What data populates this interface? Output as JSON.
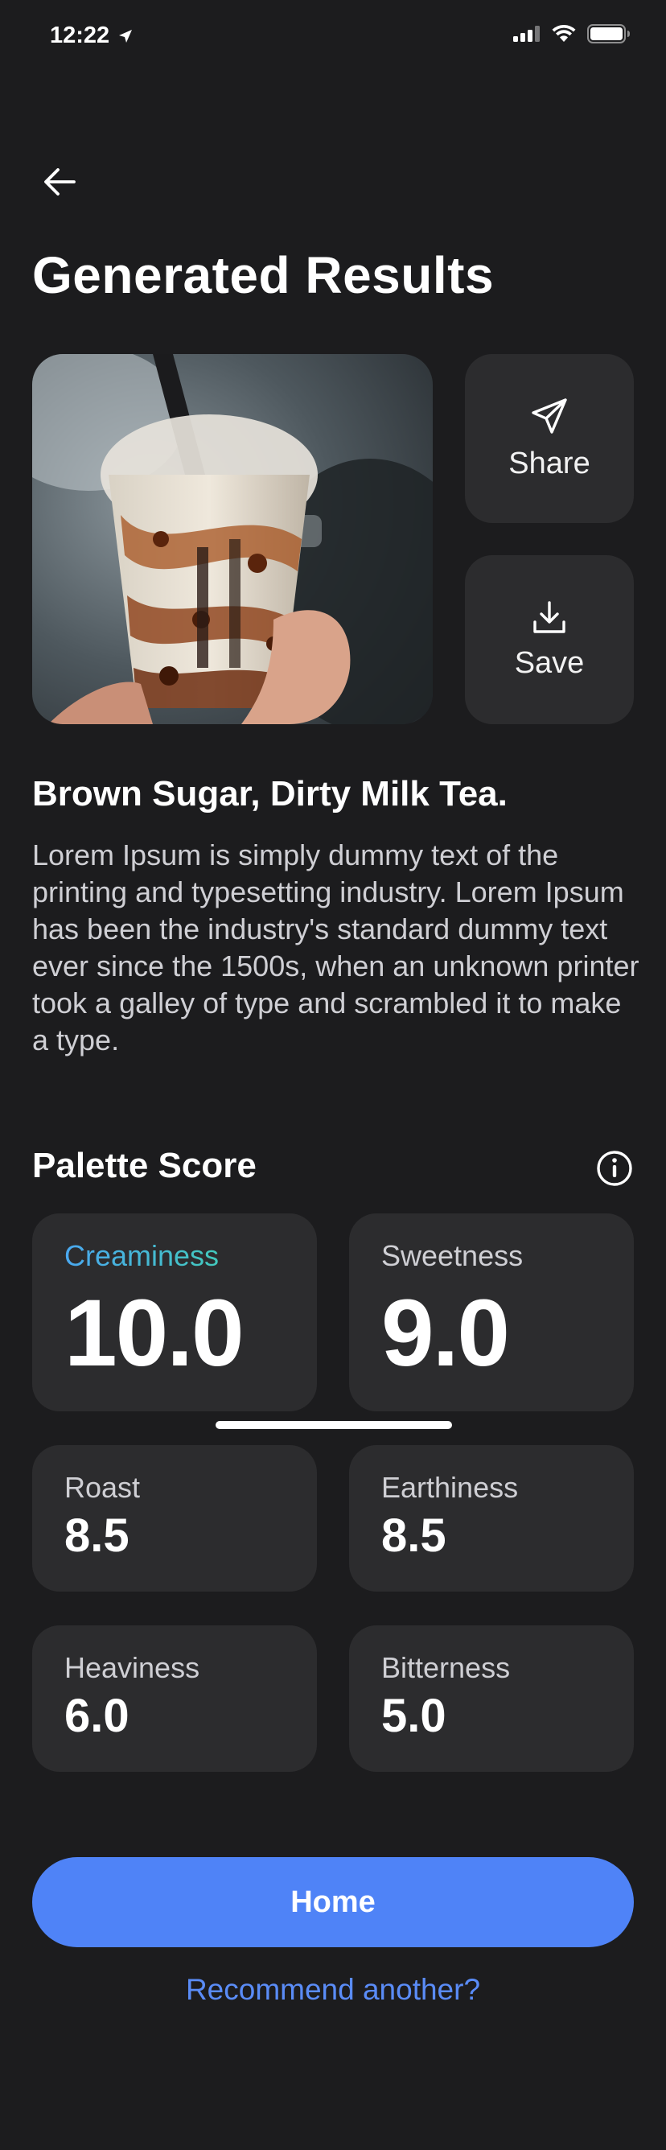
{
  "status_bar": {
    "time": "12:22"
  },
  "header": {
    "title": "Generated Results"
  },
  "actions": {
    "share_label": "Share",
    "save_label": "Save"
  },
  "drink": {
    "name": "Brown Sugar, Dirty Milk Tea.",
    "description": "Lorem Ipsum is simply dummy text of the printing and typesetting industry. Lorem Ipsum has been the industry's standard dummy text ever since the 1500s, when an unknown printer took a galley of type and scrambled it to make a type."
  },
  "palette": {
    "title": "Palette Score",
    "scores": [
      {
        "label": "Creaminess",
        "value": "10.0"
      },
      {
        "label": "Sweetness",
        "value": "9.0"
      },
      {
        "label": "Roast",
        "value": "8.5"
      },
      {
        "label": "Earthiness",
        "value": "8.5"
      },
      {
        "label": "Heaviness",
        "value": "6.0"
      },
      {
        "label": "Bitterness",
        "value": "5.0"
      }
    ]
  },
  "footer": {
    "home_label": "Home",
    "recommend_label": "Recommend another?"
  },
  "colors": {
    "background": "#1c1c1e",
    "card": "#2c2c2e",
    "accent": "#4f83f7",
    "link": "#5a8cf7"
  }
}
